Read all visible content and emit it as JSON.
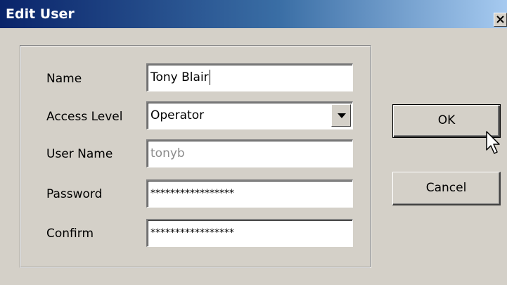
{
  "window": {
    "title": "Edit User",
    "close_label": "close"
  },
  "form": {
    "name_label": "Name",
    "name_value": "Tony Blair",
    "access_label": "Access Level",
    "access_value": "Operator",
    "username_label": "User Name",
    "username_value": "tonyb",
    "password_label": "Password",
    "password_value": "*****************",
    "confirm_label": "Confirm",
    "confirm_value": "*****************"
  },
  "buttons": {
    "ok_label": "OK",
    "cancel_label": "Cancel"
  },
  "icons": {
    "close": "close-icon",
    "dropdown": "chevron-down-icon",
    "cursor": "mouse-pointer-icon"
  }
}
